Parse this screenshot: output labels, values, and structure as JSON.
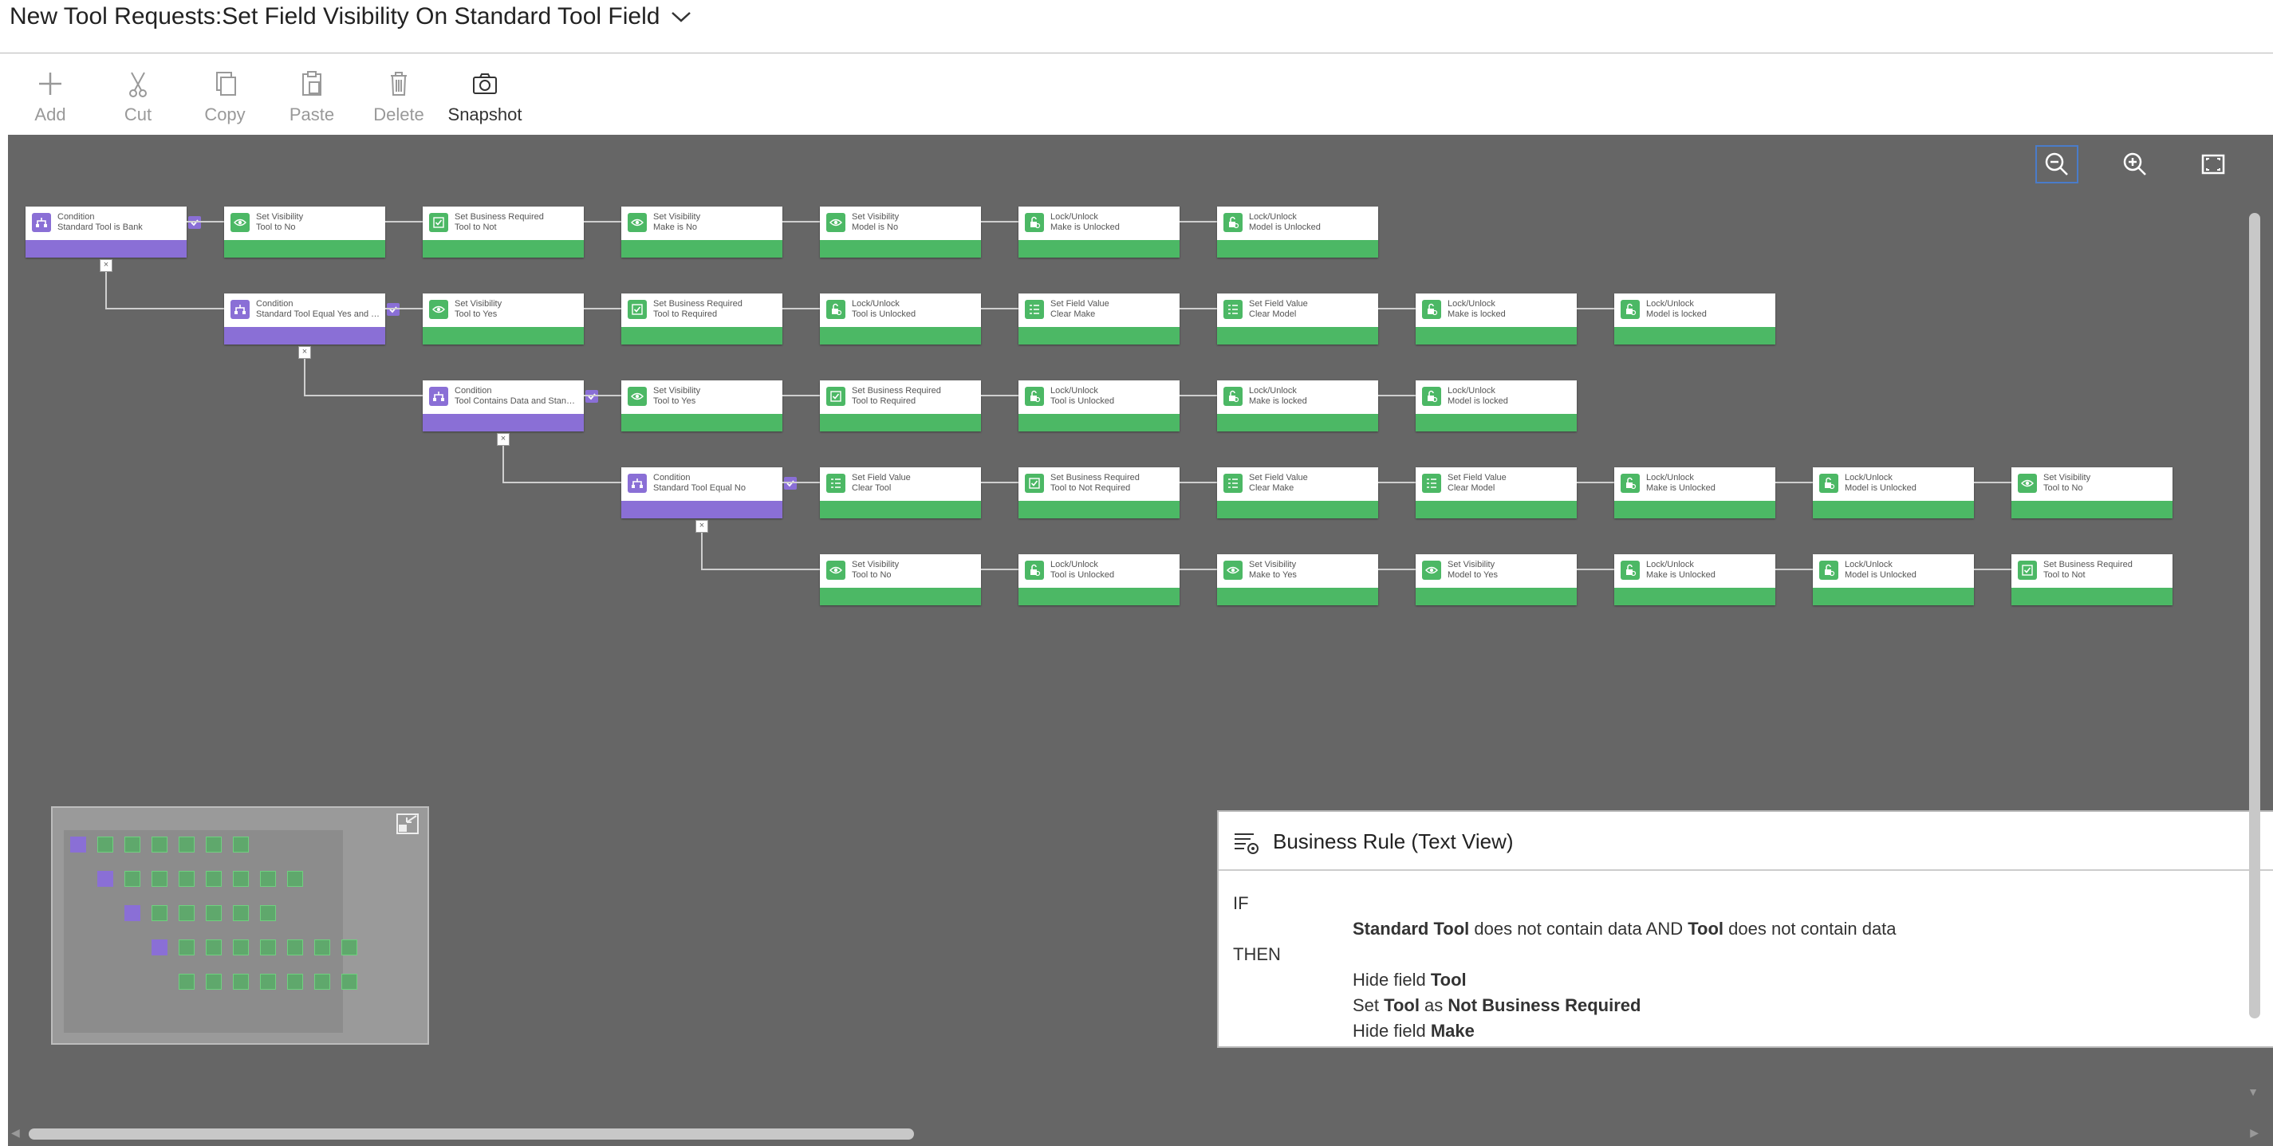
{
  "header": {
    "title": "New Tool Requests:Set Field Visibility On Standard Tool Field"
  },
  "toolbar": {
    "add": "Add",
    "cut": "Cut",
    "copy": "Copy",
    "paste": "Paste",
    "delete": "Delete",
    "snapshot": "Snapshot"
  },
  "colors": {
    "condition": "#8a6fd6",
    "action": "#4cb865",
    "canvas": "#666666"
  },
  "flow": {
    "row1": [
      {
        "t": "Condition",
        "s": "Standard Tool is Bank",
        "k": "cond"
      },
      {
        "t": "Set Visibility",
        "s": "Tool to No",
        "k": "eye"
      },
      {
        "t": "Set Business Required",
        "s": "Tool to Not",
        "k": "req"
      },
      {
        "t": "Set Visibility",
        "s": "Make is No",
        "k": "eye"
      },
      {
        "t": "Set Visibility",
        "s": "Model is No",
        "k": "eye"
      },
      {
        "t": "Lock/Unlock",
        "s": "Make is Unlocked",
        "k": "lock"
      },
      {
        "t": "Lock/Unlock",
        "s": "Model is Unlocked",
        "k": "lock"
      }
    ],
    "row2": [
      {
        "t": "Condition",
        "s": "Standard Tool Equal Yes and Too...",
        "k": "cond"
      },
      {
        "t": "Set Visibility",
        "s": "Tool to Yes",
        "k": "eye"
      },
      {
        "t": "Set Business Required",
        "s": "Tool to Required",
        "k": "req"
      },
      {
        "t": "Lock/Unlock",
        "s": "Tool is Unlocked",
        "k": "lock"
      },
      {
        "t": "Set Field Value",
        "s": "Clear Make",
        "k": "val"
      },
      {
        "t": "Set Field Value",
        "s": "Clear Model",
        "k": "val"
      },
      {
        "t": "Lock/Unlock",
        "s": "Make is locked",
        "k": "lock"
      },
      {
        "t": "Lock/Unlock",
        "s": "Model is locked",
        "k": "lock"
      }
    ],
    "row3": [
      {
        "t": "Condition",
        "s": "Tool Contains Data and Standar...",
        "k": "cond"
      },
      {
        "t": "Set Visibility",
        "s": "Tool to Yes",
        "k": "eye"
      },
      {
        "t": "Set Business Required",
        "s": "Tool to Required",
        "k": "req"
      },
      {
        "t": "Lock/Unlock",
        "s": "Tool is Unlocked",
        "k": "lock"
      },
      {
        "t": "Lock/Unlock",
        "s": "Make is locked",
        "k": "lock"
      },
      {
        "t": "Lock/Unlock",
        "s": "Model is locked",
        "k": "lock"
      }
    ],
    "row4": [
      {
        "t": "Condition",
        "s": "Standard Tool Equal No",
        "k": "cond"
      },
      {
        "t": "Set Field Value",
        "s": "Clear Tool",
        "k": "val"
      },
      {
        "t": "Set Business Required",
        "s": "Tool to Not Required",
        "k": "req"
      },
      {
        "t": "Set Field Value",
        "s": "Clear Make",
        "k": "val"
      },
      {
        "t": "Set Field Value",
        "s": "Clear Model",
        "k": "val"
      },
      {
        "t": "Lock/Unlock",
        "s": "Make is Unlocked",
        "k": "lock"
      },
      {
        "t": "Lock/Unlock",
        "s": "Model is Unlocked",
        "k": "lock"
      },
      {
        "t": "Set Visibility",
        "s": "Tool to No",
        "k": "eye"
      }
    ],
    "row5": [
      {
        "t": "Set Visibility",
        "s": "Tool to No",
        "k": "eye"
      },
      {
        "t": "Lock/Unlock",
        "s": "Tool is Unlocked",
        "k": "lock"
      },
      {
        "t": "Set Visibility",
        "s": "Make to Yes",
        "k": "eye"
      },
      {
        "t": "Set Visibility",
        "s": "Model to Yes",
        "k": "eye"
      },
      {
        "t": "Lock/Unlock",
        "s": "Make is Unlocked",
        "k": "lock"
      },
      {
        "t": "Lock/Unlock",
        "s": "Model is Unlocked",
        "k": "lock"
      },
      {
        "t": "Set Business Required",
        "s": "Tool to Not",
        "k": "req"
      }
    ]
  },
  "panel": {
    "title": "Business Rule (Text View)",
    "if": "IF",
    "then": "THEN",
    "cond_parts": [
      "Standard Tool",
      " does not contain data AND ",
      "Tool",
      " does not contain data"
    ],
    "line1": [
      "Hide field ",
      "Tool"
    ],
    "line2": [
      "Set ",
      "Tool",
      " as ",
      "Not Business Required"
    ],
    "line3": [
      "Hide field ",
      "Make"
    ]
  }
}
